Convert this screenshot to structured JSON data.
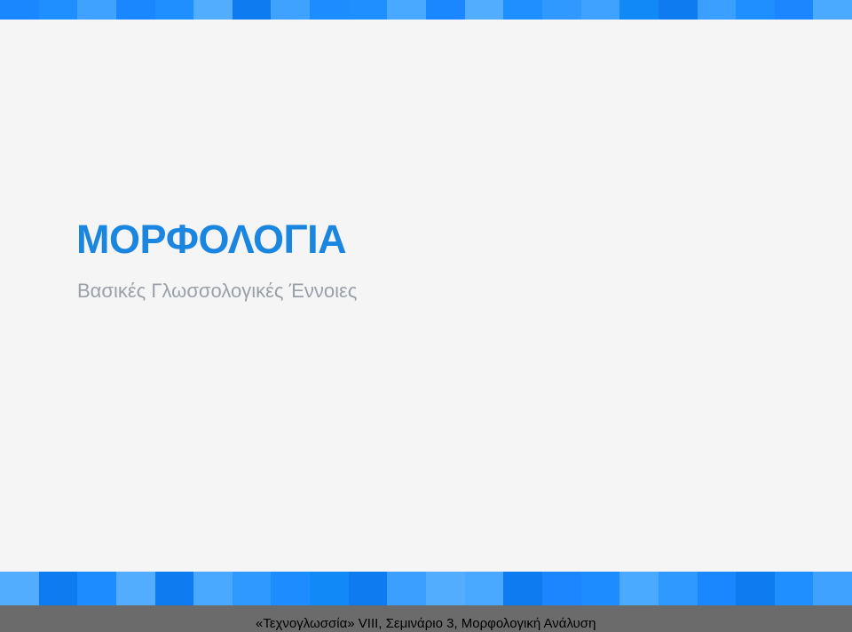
{
  "slide": {
    "title": "ΜΟΡΦΟΛΟΓΙΑ",
    "subtitle": "Βασικές Γλωσσολογικές Έννοιες"
  },
  "footer": {
    "text": "«Τεχνογλωσσία» VIII, Σεμινάριο 3, Μορφολογική Ανάλυση"
  },
  "colors": {
    "title": "#1a86e0",
    "subtitle": "#9aa0a8",
    "background": "#f5f5f5",
    "footer_bar": "#6b6b6b",
    "stripe_palette": [
      "#1a86ff",
      "#1f8fff",
      "#3fa2ff",
      "#52adff",
      "#0f7bf0",
      "#1d8cff",
      "#49a8ff",
      "#2f99ff",
      "#118af8",
      "#3a9fff",
      "#1b86ff",
      "#4aaaff"
    ]
  }
}
